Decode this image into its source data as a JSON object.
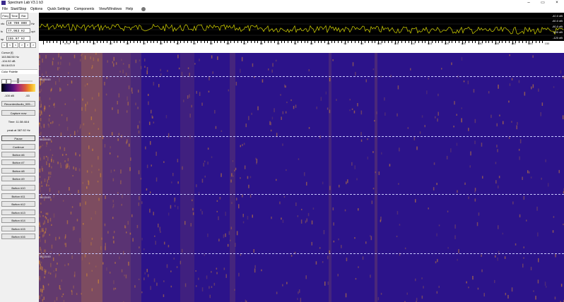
{
  "window": {
    "title": "Spectrum Lab V3.1 b3",
    "min_glyph": "–",
    "max_glyph": "▭",
    "close_glyph": "×"
  },
  "menu": [
    "File",
    "Start/Stop",
    "Options",
    "Quick Settings",
    "Components",
    "View/Windows",
    "Help"
  ],
  "tabs": [
    "Freq",
    "Time",
    "Rdr"
  ],
  "controls": {
    "vfo_label": "vfo",
    "vfo_value": "10 700 000",
    "vfo_unit": "Hz",
    "fc_label": "fc",
    "fc_value": "77.963 Hz",
    "fc_unit": "opt",
    "sp_label": "sp",
    "sp_value": "155.97 Hz",
    "step_buttons": [
      "<",
      "<",
      "<",
      ">",
      ">",
      ">"
    ]
  },
  "readout": {
    "title": "Cursor [f]",
    "freq": "163.56230 Hz",
    "level": "-104.92 dB",
    "time": "06:16:03.9"
  },
  "palette": {
    "title": "Color Palette",
    "min_label": "-100 dB",
    "max_label": "-53"
  },
  "panel": {
    "file_button": "RecordedAudio_005...",
    "capture_button": "Capture now",
    "time_text": "Time:  11:38:48.6",
    "peak_text": "peak at 387.92 Hz",
    "pause_button": "Pause",
    "continue_button": "Continue",
    "buttons": [
      "Button #6",
      "Button #7",
      "Button #8",
      "Button #9",
      "Button #10",
      "Button #11",
      "Button #12",
      "Button #13",
      "Button #14",
      "Button #15",
      "Button #16"
    ]
  },
  "spectrum": {
    "db_labels": [
      "-40.0 dB",
      "-60.0 dB",
      "-80.0 dB",
      "-100 dB",
      "-120 dB"
    ],
    "trace_color": "#d8d800",
    "background": "#000000"
  },
  "ruler": {
    "first_label": "5 Hz",
    "labels": [
      "10",
      "15",
      "20",
      "25",
      "30",
      "35",
      "40",
      "45",
      "50",
      "55",
      "60",
      "65",
      "70",
      "75",
      "80",
      "85",
      "90",
      "95",
      "100",
      "105",
      "110",
      "115",
      "120",
      "125",
      "130",
      "135",
      "140",
      "145",
      "150"
    ]
  },
  "waterfall": {
    "time_labels": [
      "06:20:00",
      "06:20:00",
      "06:15:00",
      "06:15:00"
    ],
    "colors": {
      "base": "#2c138a",
      "hot": "#e6962c"
    }
  }
}
